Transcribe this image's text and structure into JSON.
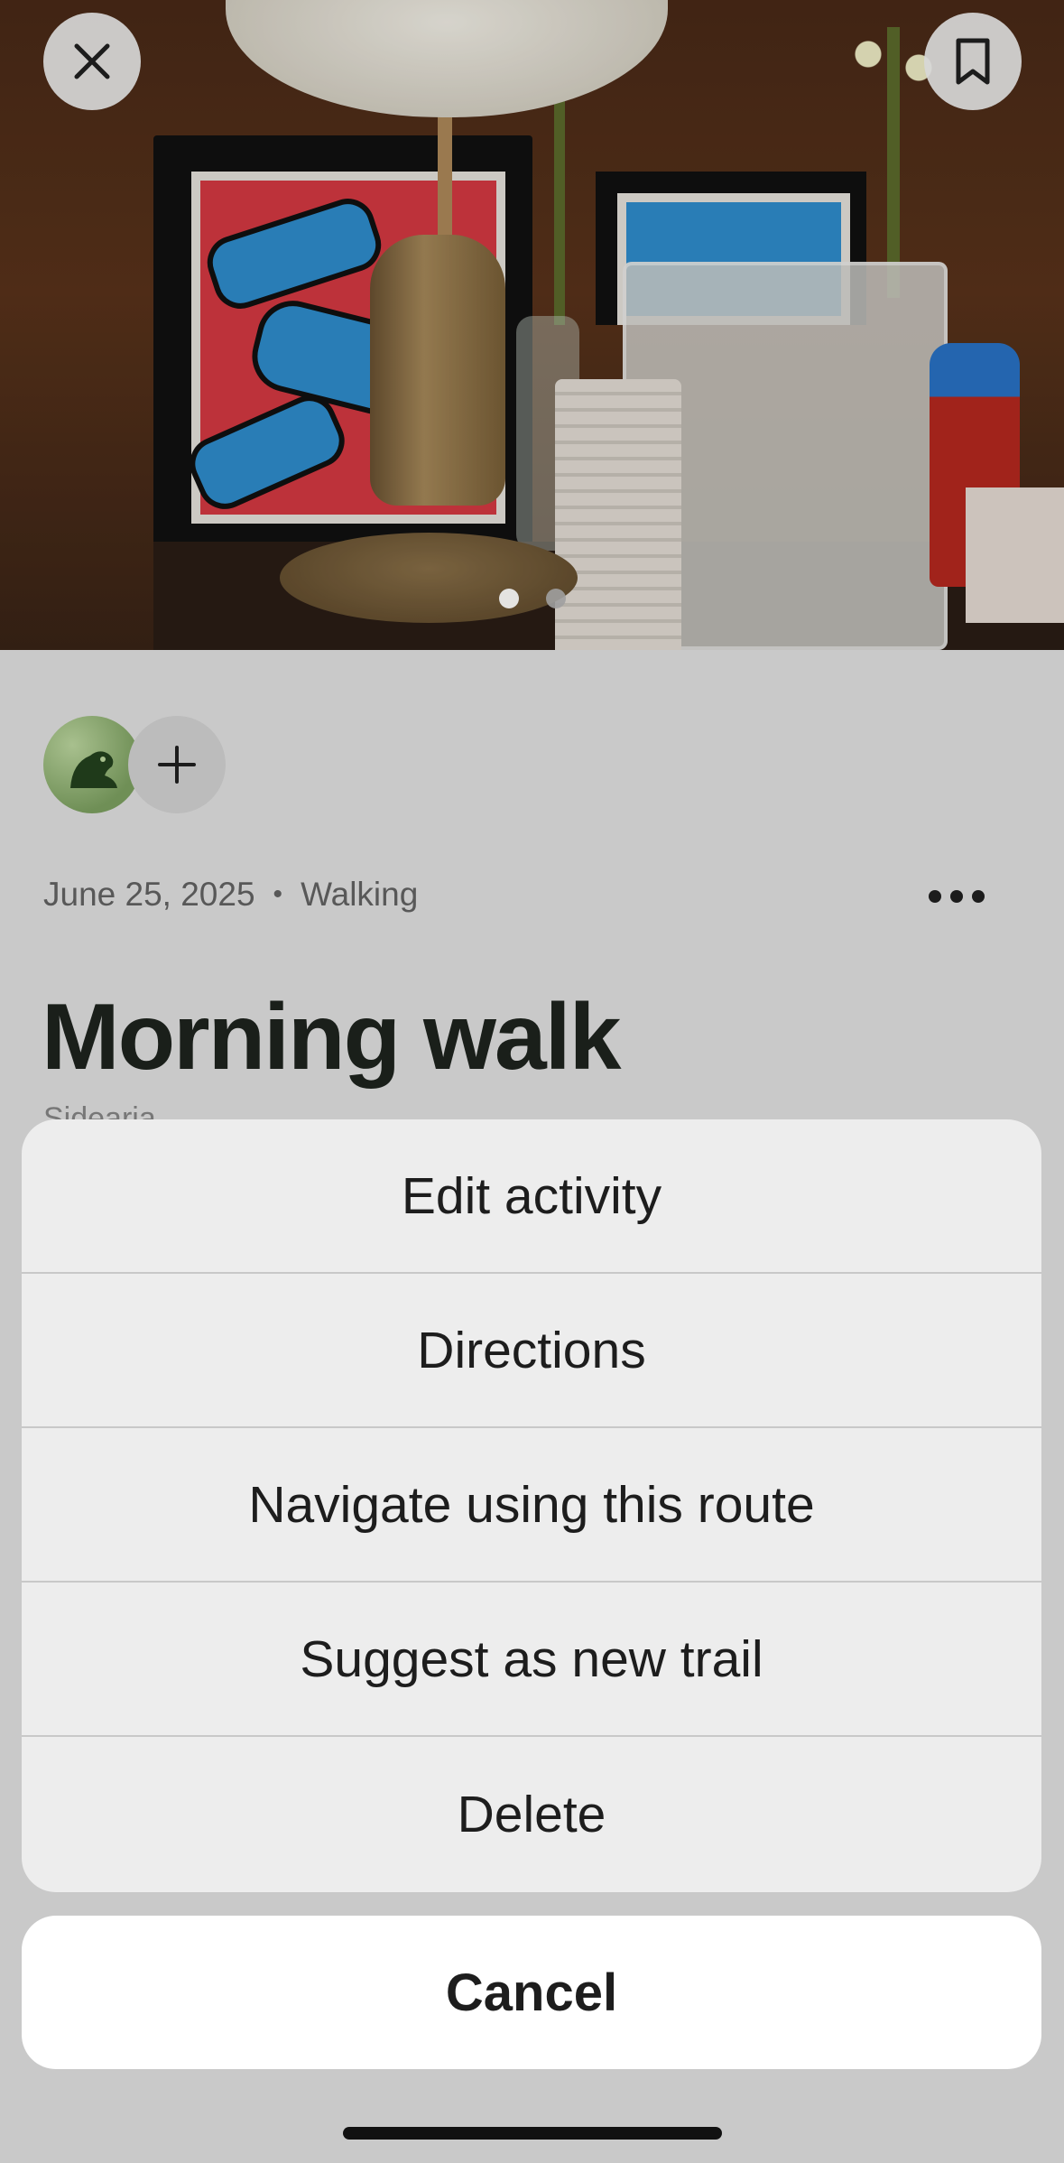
{
  "activity": {
    "date": "June 25, 2025",
    "separator": "•",
    "type": "Walking",
    "title": "Morning walk",
    "subtitle": "Sidearia"
  },
  "photo": {
    "image_count": 2,
    "active_index": 1
  },
  "header_icons": {
    "close": "close-icon",
    "bookmark": "bookmark-icon"
  },
  "action_sheet": {
    "items": [
      "Edit activity",
      "Directions",
      "Navigate using this route",
      "Suggest as new trail",
      "Delete"
    ],
    "cancel_label": "Cancel"
  },
  "colors": {
    "sheet_bg": "#ededed",
    "overlay_bg": "#c9c9c9",
    "title_text": "#1a1f1a"
  }
}
